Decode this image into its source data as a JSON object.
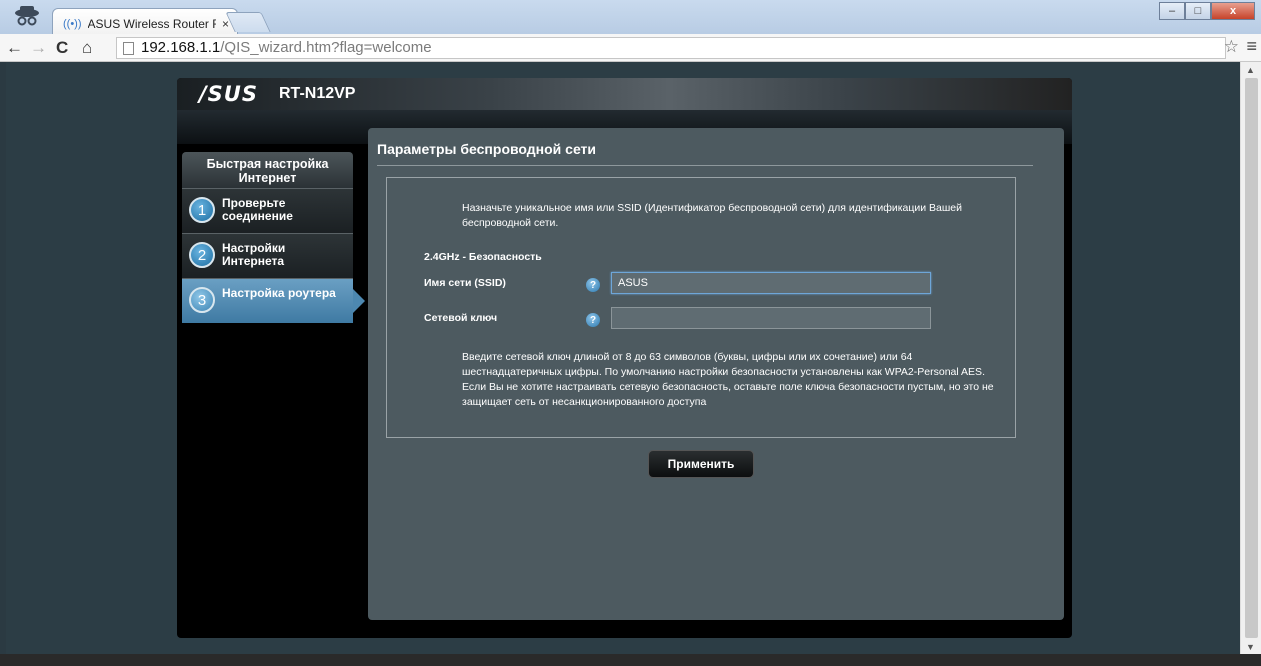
{
  "browser": {
    "tab_title": "ASUS Wireless Router RT-",
    "tab_close": "×",
    "url_host": "192.168.1.1",
    "url_path": "/QIS_wizard.htm?flag=welcome",
    "window_buttons": [
      "–",
      "□",
      "x"
    ]
  },
  "router": {
    "logo": "/SUS",
    "model": "RT-N12VP"
  },
  "sidebar": {
    "title": "Быстрая настройка Интернет",
    "steps": [
      {
        "num": "1",
        "label": "Проверьте соединение"
      },
      {
        "num": "2",
        "label": "Настройки Интернета"
      },
      {
        "num": "3",
        "label": "Настройка роутера"
      }
    ]
  },
  "main": {
    "title": "Параметры беспроводной сети",
    "description": "Назначьте уникальное имя или SSID (Идентификатор беспроводной сети) для идентификации Вашей беспроводной сети.",
    "section": "2.4GHz - Безопасность",
    "ssid_label": "Имя сети (SSID)",
    "ssid_value": "ASUS",
    "key_label": "Сетевой ключ",
    "key_value": "",
    "help_glyph": "?",
    "note": "Введите сетевой ключ длиной от 8 до 63 символов (буквы, цифры или их сочетание) или 64 шестнадцатеричных цифры. По умолчанию настройки безопасности установлены как WPA2-Personal AES. Если Вы не хотите настраивать сетевую безопасность, оставьте поле ключа безопасности пустым, но это не защищает сеть от несанкционированного доступа",
    "apply_label": "Применить"
  }
}
